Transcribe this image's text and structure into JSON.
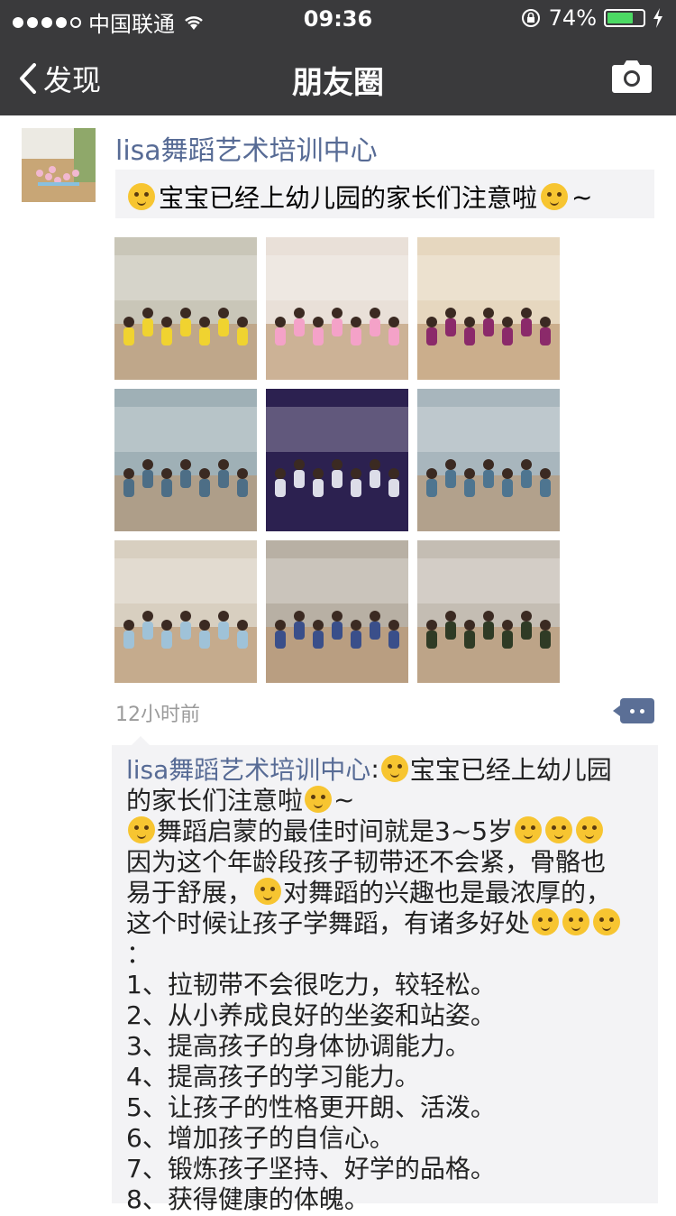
{
  "status": {
    "carrier": "中国联通",
    "time": "09:36",
    "battery": "74%",
    "battery_level": 0.74
  },
  "nav": {
    "back": "发现",
    "title": "朋友圈"
  },
  "post": {
    "user": "lisa舞蹈艺术培训中心",
    "share_text": "宝宝已经上幼儿园的家长们注意啦",
    "share_suffix": "~",
    "timestamp": "12小时前",
    "photos": [
      {
        "name": "photo-1",
        "bg": "#c9c6b8",
        "accent": "#f0d330"
      },
      {
        "name": "photo-2",
        "bg": "#e9e0d8",
        "accent": "#f4a2c8"
      },
      {
        "name": "photo-3",
        "bg": "#e6d7bf",
        "accent": "#8b2a6a"
      },
      {
        "name": "photo-4",
        "bg": "#9fb0b6",
        "accent": "#4d6e86"
      },
      {
        "name": "photo-5",
        "bg": "#2c2150",
        "accent": "#dcdde8"
      },
      {
        "name": "photo-6",
        "bg": "#a8b6bd",
        "accent": "#4e7590"
      },
      {
        "name": "photo-7",
        "bg": "#d8cfc0",
        "accent": "#9fc2d8"
      },
      {
        "name": "photo-8",
        "bg": "#b8b0a4",
        "accent": "#3a4f8a"
      },
      {
        "name": "photo-9",
        "bg": "#c4bdb3",
        "accent": "#2f3b25"
      }
    ]
  },
  "comment": {
    "author": "lisa舞蹈艺术培训中心",
    "sep": ":",
    "line1_text": "宝宝已经上幼儿园",
    "line2_text": "的家长们注意啦",
    "line2_suffix": "~",
    "line3_text": "舞蹈启蒙的最佳时间就是3~5岁",
    "line4": "因为这个年龄段孩子韧带还不会紧，骨骼也",
    "line5_a": "易于舒展，",
    "line5_b": "对舞蹈的兴趣也是最浓厚的，",
    "line6": "这个时候让孩子学舞蹈，有诸多好处",
    "line7": "：",
    "items": [
      "1、拉韧带不会很吃力，较轻松。",
      "2、从小养成良好的坐姿和站姿。",
      "3、提高孩子的身体协调能力。",
      "4、提高孩子的学习能力。",
      "5、让孩子的性格更开朗、活泼。",
      "6、增加孩子的自信心。",
      "7、锻炼孩子坚持、好学的品格。",
      "8、获得健康的体魄。"
    ]
  }
}
